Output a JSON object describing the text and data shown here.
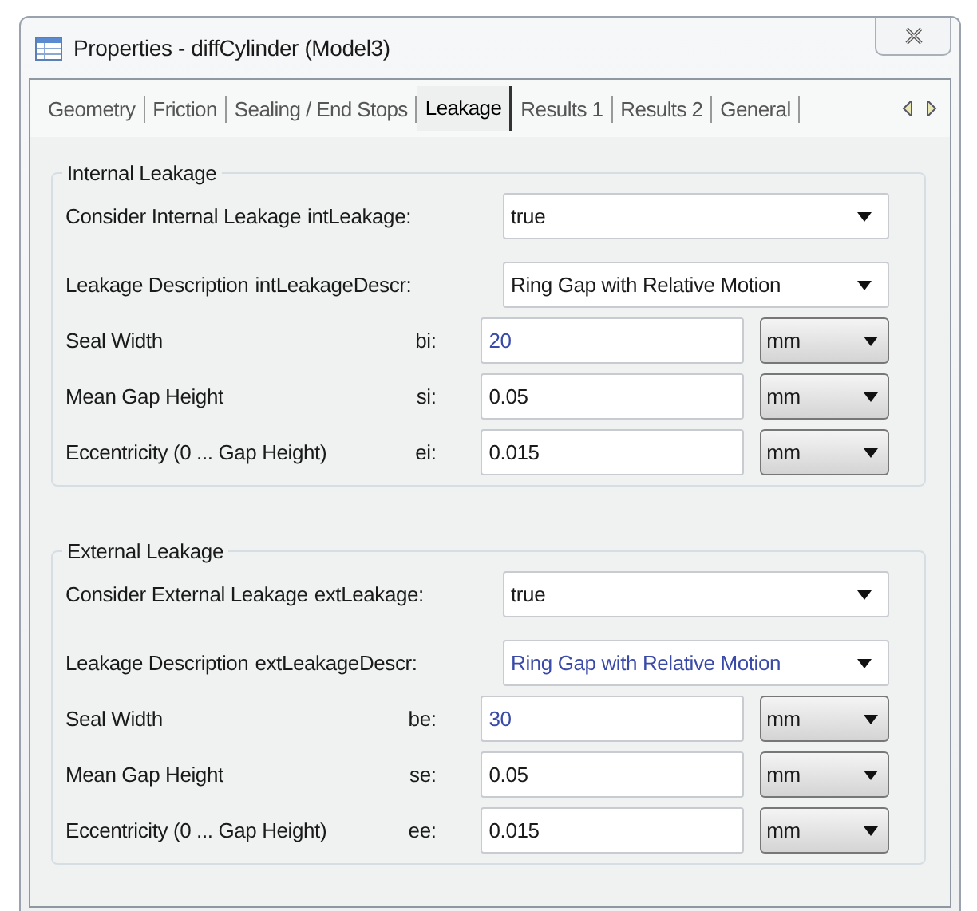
{
  "window": {
    "title": "Properties - diffCylinder (Model3)"
  },
  "tabs": [
    {
      "label": "Geometry",
      "selected": false
    },
    {
      "label": "Friction",
      "selected": false
    },
    {
      "label": "Sealing / End Stops",
      "selected": false
    },
    {
      "label": "Leakage",
      "selected": true
    },
    {
      "label": "Results 1",
      "selected": false
    },
    {
      "label": "Results 2",
      "selected": false
    },
    {
      "label": "General",
      "selected": false
    }
  ],
  "groups": [
    {
      "title": "Internal Leakage",
      "rows": [
        {
          "kind": "select",
          "label": "Consider Internal Leakage",
          "param": "intLeakage:",
          "value": "true",
          "modified": false
        },
        {
          "kind": "select",
          "label": "Leakage Description",
          "param": "intLeakageDescr:",
          "value": "Ring Gap with Relative Motion",
          "modified": false
        },
        {
          "kind": "quantity",
          "label": "Seal Width",
          "param": "bi:",
          "value": "20",
          "modified": true,
          "unit": "mm"
        },
        {
          "kind": "quantity",
          "label": "Mean Gap Height",
          "param": "si:",
          "value": "0.05",
          "modified": false,
          "unit": "mm"
        },
        {
          "kind": "quantity",
          "label": "Eccentricity (0 ... Gap Height)",
          "param": "ei:",
          "value": "0.015",
          "modified": false,
          "unit": "mm"
        }
      ]
    },
    {
      "title": "External Leakage",
      "rows": [
        {
          "kind": "select",
          "label": "Consider External Leakage",
          "param": "extLeakage:",
          "value": "true",
          "modified": false
        },
        {
          "kind": "select",
          "label": "Leakage Description",
          "param": "extLeakageDescr:",
          "value": "Ring Gap with Relative Motion",
          "modified": true
        },
        {
          "kind": "quantity",
          "label": "Seal Width",
          "param": "be:",
          "value": "30",
          "modified": true,
          "unit": "mm"
        },
        {
          "kind": "quantity",
          "label": "Mean Gap Height",
          "param": "se:",
          "value": "0.05",
          "modified": false,
          "unit": "mm"
        },
        {
          "kind": "quantity",
          "label": "Eccentricity (0 ... Gap Height)",
          "param": "ee:",
          "value": "0.015",
          "modified": false,
          "unit": "mm"
        }
      ]
    }
  ]
}
